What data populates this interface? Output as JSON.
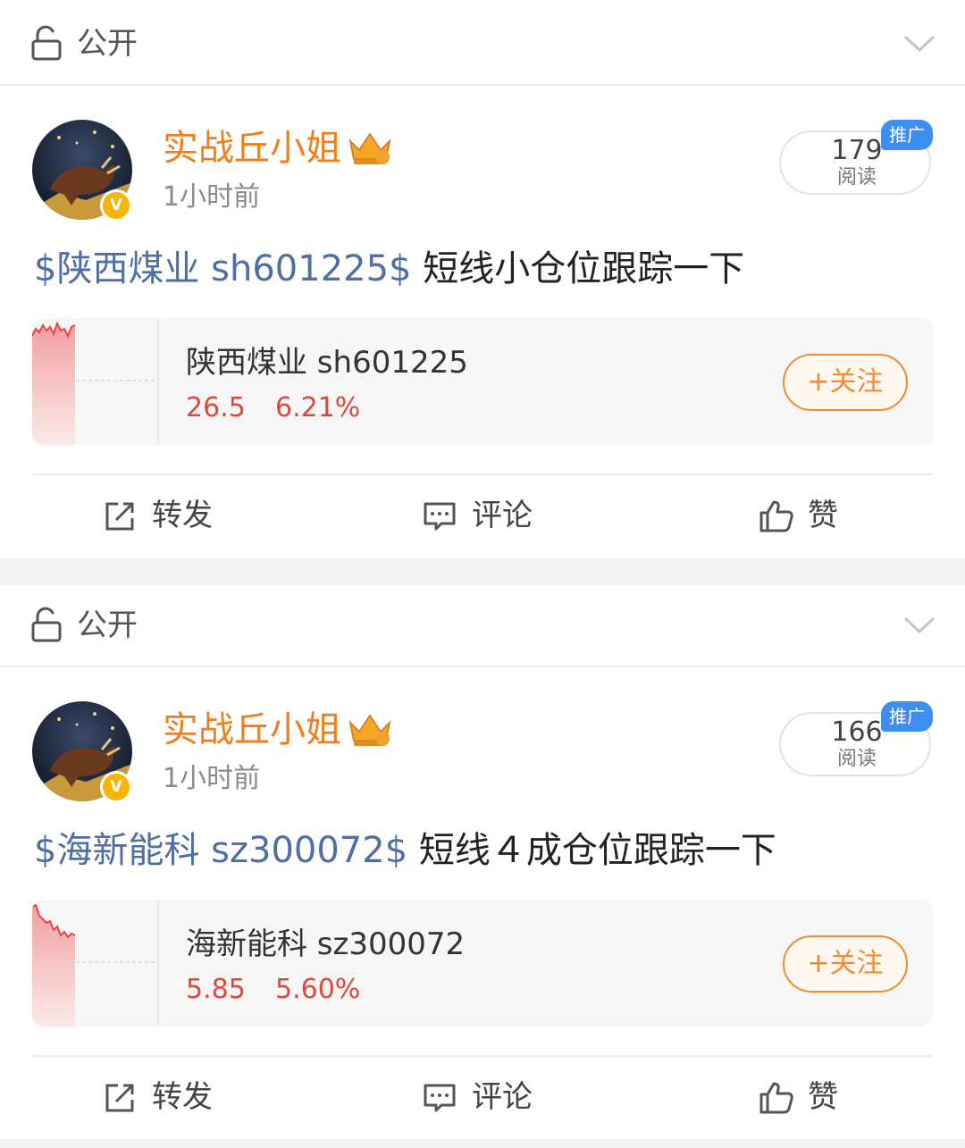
{
  "posts": [
    {
      "visibility": "公开",
      "username": "实战丘小姐",
      "time": "1小时前",
      "reads": "179",
      "reads_label": "阅读",
      "promo_badge": "推广",
      "text_tag": "$陕西煤业 sh601225$",
      "text_body": " 短线小仓位跟踪一下",
      "stock": {
        "name": "陕西煤业 sh601225",
        "price": "26.5",
        "change": "6.21%",
        "follow_label": "+关注"
      },
      "actions": {
        "repost": "转发",
        "comment": "评论",
        "like": "赞"
      }
    },
    {
      "visibility": "公开",
      "username": "实战丘小姐",
      "time": "1小时前",
      "reads": "166",
      "reads_label": "阅读",
      "promo_badge": "推广",
      "text_tag": "$海新能科 sz300072$",
      "text_body": " 短线４成仓位跟踪一下",
      "stock": {
        "name": "海新能科 sz300072",
        "price": "5.85",
        "change": "5.60%",
        "follow_label": "+关注"
      },
      "actions": {
        "repost": "转发",
        "comment": "评论",
        "like": "赞"
      }
    }
  ],
  "verified_mark": "V",
  "colors": {
    "username": "#f07e1b",
    "stock_tag": "#4e6fa6",
    "price_up": "#e0473c",
    "follow": "#f28b2e",
    "promo": "#3d8ef0"
  }
}
